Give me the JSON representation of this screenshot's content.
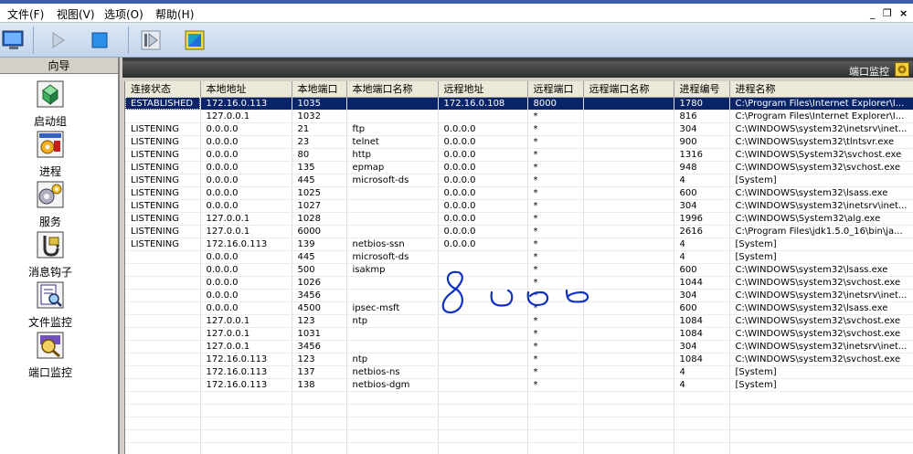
{
  "menu": {
    "file": "文件(F)",
    "view": "视图(V)",
    "options": "选项(O)",
    "help": "帮助(H)",
    "minimize": "_",
    "restore": "❐",
    "close": "×"
  },
  "nav": {
    "header": "向导",
    "items": [
      {
        "label": "启动组"
      },
      {
        "label": "进程"
      },
      {
        "label": "服务"
      },
      {
        "label": "消息钩子"
      },
      {
        "label": "文件监控"
      },
      {
        "label": "端口监控"
      }
    ]
  },
  "panel": {
    "title": "端口监控"
  },
  "table": {
    "columns": [
      "连接状态",
      "本地地址",
      "本地端口",
      "本地端口名称",
      "远程地址",
      "远程端口",
      "远程端口名称",
      "进程编号",
      "进程名称"
    ],
    "rows": [
      [
        "ESTABLISHED",
        "172.16.0.113",
        "1035",
        "",
        "172.16.0.108",
        "8000",
        "",
        "1780",
        "C:\\Program Files\\Internet Explorer\\I..."
      ],
      [
        "",
        "127.0.0.1",
        "1032",
        "",
        "",
        "*",
        "",
        "816",
        "C:\\Program Files\\Internet Explorer\\I..."
      ],
      [
        "LISTENING",
        "0.0.0.0",
        "21",
        "ftp",
        "0.0.0.0",
        "*",
        "",
        "304",
        "C:\\WINDOWS\\system32\\inetsrv\\inet..."
      ],
      [
        "LISTENING",
        "0.0.0.0",
        "23",
        "telnet",
        "0.0.0.0",
        "*",
        "",
        "900",
        "C:\\WINDOWS\\system32\\tlntsvr.exe"
      ],
      [
        "LISTENING",
        "0.0.0.0",
        "80",
        "http",
        "0.0.0.0",
        "*",
        "",
        "1316",
        "C:\\WINDOWS\\System32\\svchost.exe"
      ],
      [
        "LISTENING",
        "0.0.0.0",
        "135",
        "epmap",
        "0.0.0.0",
        "*",
        "",
        "948",
        "C:\\WINDOWS\\system32\\svchost.exe"
      ],
      [
        "LISTENING",
        "0.0.0.0",
        "445",
        "microsoft-ds",
        "0.0.0.0",
        "*",
        "",
        "4",
        "[System]"
      ],
      [
        "LISTENING",
        "0.0.0.0",
        "1025",
        "",
        "0.0.0.0",
        "*",
        "",
        "600",
        "C:\\WINDOWS\\system32\\lsass.exe"
      ],
      [
        "LISTENING",
        "0.0.0.0",
        "1027",
        "",
        "0.0.0.0",
        "*",
        "",
        "304",
        "C:\\WINDOWS\\system32\\inetsrv\\inet..."
      ],
      [
        "LISTENING",
        "127.0.0.1",
        "1028",
        "",
        "0.0.0.0",
        "*",
        "",
        "1996",
        "C:\\WINDOWS\\System32\\alg.exe"
      ],
      [
        "LISTENING",
        "127.0.0.1",
        "6000",
        "",
        "0.0.0.0",
        "*",
        "",
        "2616",
        "C:\\Program Files\\jdk1.5.0_16\\bin\\ja..."
      ],
      [
        "LISTENING",
        "172.16.0.113",
        "139",
        "netbios-ssn",
        "0.0.0.0",
        "*",
        "",
        "4",
        "[System]"
      ],
      [
        "",
        "0.0.0.0",
        "445",
        "microsoft-ds",
        "",
        "*",
        "",
        "4",
        "[System]"
      ],
      [
        "",
        "0.0.0.0",
        "500",
        "isakmp",
        "",
        "*",
        "",
        "600",
        "C:\\WINDOWS\\system32\\lsass.exe"
      ],
      [
        "",
        "0.0.0.0",
        "1026",
        "",
        "",
        "*",
        "",
        "1044",
        "C:\\WINDOWS\\system32\\svchost.exe"
      ],
      [
        "",
        "0.0.0.0",
        "3456",
        "",
        "",
        "*",
        "",
        "304",
        "C:\\WINDOWS\\system32\\inetsrv\\inet..."
      ],
      [
        "",
        "0.0.0.0",
        "4500",
        "ipsec-msft",
        "",
        "*",
        "",
        "600",
        "C:\\WINDOWS\\system32\\lsass.exe"
      ],
      [
        "",
        "127.0.0.1",
        "123",
        "ntp",
        "",
        "*",
        "",
        "1084",
        "C:\\WINDOWS\\system32\\svchost.exe"
      ],
      [
        "",
        "127.0.0.1",
        "1031",
        "",
        "",
        "*",
        "",
        "1084",
        "C:\\WINDOWS\\system32\\svchost.exe"
      ],
      [
        "",
        "127.0.0.1",
        "3456",
        "",
        "",
        "*",
        "",
        "304",
        "C:\\WINDOWS\\system32\\inetsrv\\inet..."
      ],
      [
        "",
        "172.16.0.113",
        "123",
        "ntp",
        "",
        "*",
        "",
        "1084",
        "C:\\WINDOWS\\system32\\svchost.exe"
      ],
      [
        "",
        "172.16.0.113",
        "137",
        "netbios-ns",
        "",
        "*",
        "",
        "4",
        "[System]"
      ],
      [
        "",
        "172.16.0.113",
        "138",
        "netbios-dgm",
        "",
        "*",
        "",
        "4",
        "[System]"
      ]
    ],
    "selected_row": 0
  },
  "annotation": {
    "handwritten": "8000"
  }
}
